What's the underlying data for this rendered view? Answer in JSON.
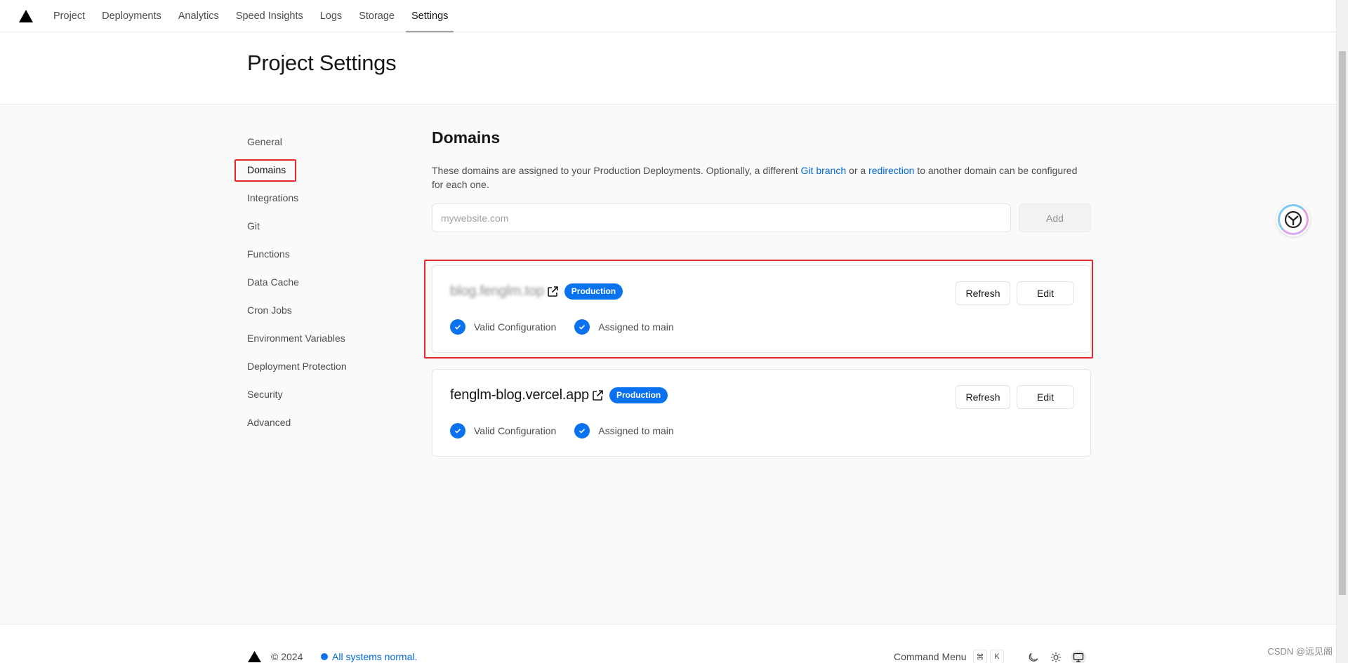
{
  "nav": {
    "tabs": [
      {
        "label": "Project"
      },
      {
        "label": "Deployments"
      },
      {
        "label": "Analytics"
      },
      {
        "label": "Speed Insights"
      },
      {
        "label": "Logs"
      },
      {
        "label": "Storage"
      },
      {
        "label": "Settings"
      }
    ],
    "active_tab": "Settings"
  },
  "header": {
    "title": "Project Settings"
  },
  "sidebar": {
    "items": [
      {
        "label": "General"
      },
      {
        "label": "Domains"
      },
      {
        "label": "Integrations"
      },
      {
        "label": "Git"
      },
      {
        "label": "Functions"
      },
      {
        "label": "Data Cache"
      },
      {
        "label": "Cron Jobs"
      },
      {
        "label": "Environment Variables"
      },
      {
        "label": "Deployment Protection"
      },
      {
        "label": "Security"
      },
      {
        "label": "Advanced"
      }
    ],
    "active_item": "Domains"
  },
  "domains": {
    "title": "Domains",
    "desc_before": "These domains are assigned to your Production Deployments. Optionally, a different ",
    "desc_link1": "Git branch",
    "desc_middle": " or a ",
    "desc_link2": "redirection",
    "desc_after": " to another domain can be configured for each one.",
    "input_placeholder": "mywebsite.com",
    "input_value": "",
    "add_label": "Add",
    "cards": [
      {
        "domain": "blog.fenglm.top",
        "blurred": true,
        "badge": "Production",
        "status1": "Valid Configuration",
        "status2": "Assigned to main",
        "refresh_label": "Refresh",
        "edit_label": "Edit"
      },
      {
        "domain": "fenglm-blog.vercel.app",
        "blurred": false,
        "badge": "Production",
        "status1": "Valid Configuration",
        "status2": "Assigned to main",
        "refresh_label": "Refresh",
        "edit_label": "Edit"
      }
    ]
  },
  "footer": {
    "copyright": "© 2024",
    "status": "All systems normal.",
    "command_menu": "Command Menu",
    "kbd1": "⌘",
    "kbd2": "K"
  },
  "watermark": "CSDN @远见阁",
  "colors": {
    "accent": "#0a72ef",
    "link": "#0068d6",
    "highlight": "#e5282b"
  }
}
